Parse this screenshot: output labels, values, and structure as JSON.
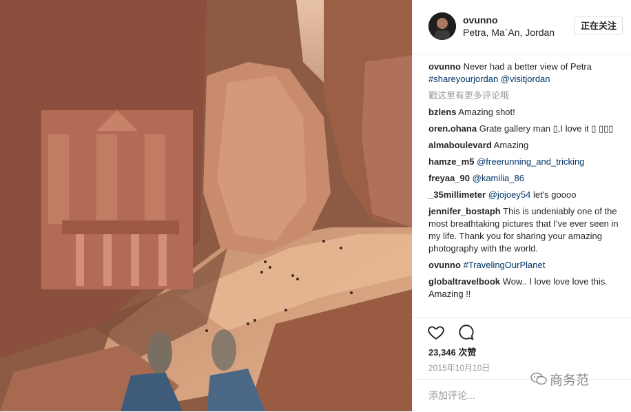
{
  "post": {
    "username": "ovunno",
    "location": "Petra, Ma`An, Jordan",
    "follow_label": "正在关注",
    "caption_user": "ovunno",
    "caption_text": "Never had a better view of Petra",
    "caption_tags": "#shareyourjordan @visitjordan",
    "more_comments": "戳这里有更多评论哦",
    "likes": "23,346 次赞",
    "date": "2015年10月10日",
    "add_comment_placeholder": "添加评论...",
    "watermark": "商务范"
  },
  "comments": [
    {
      "user": "bzlens",
      "text": "Amazing shot!"
    },
    {
      "user": "oren.ohana",
      "text": "Grate gallery man ▯,I love it ▯ ▯▯▯"
    },
    {
      "user": "almaboulevard",
      "text": "Amazing"
    },
    {
      "user": "hamze_m5",
      "text": "@freerunning_and_tricking"
    },
    {
      "user": "freyaa_90",
      "text": "@kamilia_86"
    },
    {
      "user": "_35millimeter",
      "link": "@jojoey54",
      "text": " let's goooo"
    },
    {
      "user": "jennifer_bostaph",
      "text": "This is undeniably one of the most breathtaking pictures that I've ever seen in my life. Thank you for sharing your amazing photography with the world."
    },
    {
      "user": "ovunno",
      "text": "#TravelingOurPlanet"
    },
    {
      "user": "globaltravelbook",
      "text": "Wow.. I love love love this. Amazing !!"
    }
  ],
  "icons": {
    "like": "heart-icon",
    "comment": "comment-icon",
    "watermark": "wechat-icon"
  },
  "colors": {
    "link": "#003569",
    "muted": "#999999",
    "rock": "#a8674a",
    "sand": "#d9a27c"
  }
}
